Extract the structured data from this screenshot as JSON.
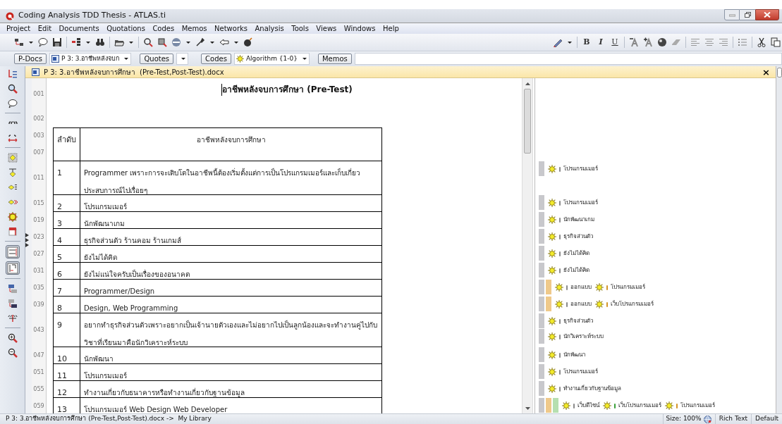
{
  "window": {
    "title": "Coding Analysis TDD Thesis - ATLAS.ti"
  },
  "menu": [
    "Project",
    "Edit",
    "Documents",
    "Quotations",
    "Codes",
    "Memos",
    "Networks",
    "Analysis",
    "Tools",
    "Views",
    "Windows",
    "Help"
  ],
  "format_toolbar": {
    "bold": "B",
    "italic": "I",
    "underline": "U"
  },
  "selectors": {
    "docs_button": "P-Docs",
    "doc_value": "P 3: 3.อาชีพหลังจบก",
    "quotes_button": "Quotes",
    "codes_button": "Codes",
    "code_value": "Algorithm {1-0}",
    "memos_button": "Memos"
  },
  "left_toolbar": [
    {
      "pressed": false
    },
    {
      "pressed": false
    },
    {
      "pressed": false
    },
    {
      "pressed": false
    },
    {
      "pressed": false
    },
    {
      "pressed": false
    },
    {
      "pressed": false
    },
    {
      "pressed": false
    },
    {
      "pressed": false
    },
    {
      "pressed": false
    },
    {
      "pressed": false
    },
    {
      "pressed": true
    },
    {
      "pressed": true
    },
    {
      "pressed": false
    },
    {
      "pressed": false
    },
    {
      "pressed": false
    },
    {
      "pressed": false
    },
    {
      "pressed": false
    }
  ],
  "document": {
    "header": "P 3: 3.อาชีพหลังจบการศึกษา  (Pre-Test,Post-Test).docx",
    "close": "×",
    "title": "อาชีพหลังจบการศึกษา (Pre-Test)",
    "title_line": "001",
    "blank_line": "002",
    "table": {
      "header_lines": [
        "003",
        "007"
      ],
      "columns": [
        "ลำดับ",
        "อาชีพหลังจบการศึกษา"
      ],
      "rows": [
        {
          "line": "011",
          "number": "1",
          "text": "Programmer เพราะการจะเติบโตในอาชีพนี้ต้องเริ่มตั้งแต่การเป็นโปรแกรมเมอร์และเก็บเกี่ยวประสบการณ์ไปเรื่อยๆ",
          "margin": [
            {
              "bars": [
                {
                  "color": "#c8c8cc"
                }
              ],
              "codes": [
                {
                  "label": "โปรแกรมเมอร์",
                  "color": "#8a8a8a"
                }
              ]
            }
          ]
        },
        {
          "line": "015",
          "number": "2",
          "text": "โปรแกรมเมอร์",
          "margin": [
            {
              "bars": [
                {
                  "color": "#c8c8cc"
                }
              ],
              "codes": [
                {
                  "label": "โปรแกรมเมอร์",
                  "color": "#8a8a8a"
                }
              ]
            }
          ]
        },
        {
          "line": "019",
          "number": "3",
          "text": "นักพัฒนาเกม",
          "margin": [
            {
              "bars": [
                {
                  "color": "#c8c8cc"
                }
              ],
              "codes": [
                {
                  "label": "นักพัฒนาเกม",
                  "color": "#8a8a8a"
                }
              ]
            }
          ]
        },
        {
          "line": "023",
          "number": "4",
          "text": "ธุรกิจส่วนตัว ร้านคอม ร้านเกมส์",
          "margin": [
            {
              "bars": [
                {
                  "color": "#c8c8cc"
                }
              ],
              "codes": [
                {
                  "label": "ธุรกิจส่วนตัว",
                  "color": "#8a8a8a"
                }
              ]
            }
          ]
        },
        {
          "line": "027",
          "number": "5",
          "text": "ยังไม่ได้คิด",
          "margin": [
            {
              "bars": [
                {
                  "color": "#c8c8cc"
                }
              ],
              "codes": [
                {
                  "label": "ยังไม่ได้คิด",
                  "color": "#8a8a8a"
                }
              ]
            }
          ]
        },
        {
          "line": "031",
          "number": "6",
          "text": "ยังไม่แน่ใจครับเป็นเรื่องของอนาคต",
          "margin": [
            {
              "bars": [
                {
                  "color": "#c8c8cc"
                }
              ],
              "codes": [
                {
                  "label": "ยังไม่ได้คิด",
                  "color": "#8a8a8a"
                }
              ]
            }
          ]
        },
        {
          "line": "035",
          "number": "7",
          "text": "Programmer/Design",
          "margin": [
            {
              "bars": [
                {
                  "color": "#c8c8cc"
                },
                {
                  "color": "#efc98a"
                }
              ],
              "codes": [
                {
                  "label": "ออกแบบ",
                  "color": "#8a8a8a"
                },
                {
                  "label": "โปรแกรมเมอร์",
                  "color": "#d4952a"
                }
              ]
            }
          ]
        },
        {
          "line": "039",
          "number": "8",
          "text": "Design, Web Programming",
          "margin": [
            {
              "bars": [
                {
                  "color": "#c8c8cc"
                },
                {
                  "color": "#efc98a"
                }
              ],
              "codes": [
                {
                  "label": "ออกแบบ",
                  "color": "#8a8a8a"
                },
                {
                  "label": "เว็บโปรแกรมเมอร์",
                  "color": "#d4952a"
                }
              ]
            }
          ]
        },
        {
          "line": "043",
          "number": "9",
          "text": "อยากทำธุรกิจส่วนตัวเพราะอยากเป็นเจ้านายตัวเองและไม่อยากไปเป็นลูกน้องและจะทำงานคู่ไปกับวิชาที่เรียนมาคือนักวิเคราะห์ระบบ",
          "margin": [
            {
              "bars": [
                {
                  "color": "#c8c8cc"
                }
              ],
              "codes": [
                {
                  "label": "ธุรกิจส่วนตัว",
                  "color": "#8a8a8a"
                }
              ]
            },
            {
              "bars": [
                {
                  "color": "#c8c8cc"
                }
              ],
              "codes": [
                {
                  "label": "นักวิเคราะห์ระบบ",
                  "color": "#8a8a8a"
                }
              ]
            }
          ]
        },
        {
          "line": "047",
          "number": "10",
          "text": "นักพัฒนา",
          "margin": [
            {
              "bars": [
                {
                  "color": "#c8c8cc"
                }
              ],
              "codes": [
                {
                  "label": "นักพัฒนา",
                  "color": "#8a8a8a"
                }
              ]
            }
          ]
        },
        {
          "line": "051",
          "number": "11",
          "text": "โปรแกรมเมอร์",
          "margin": [
            {
              "bars": [
                {
                  "color": "#c8c8cc"
                }
              ],
              "codes": [
                {
                  "label": "โปรแกรมเมอร์",
                  "color": "#8a8a8a"
                }
              ]
            }
          ]
        },
        {
          "line": "055",
          "number": "12",
          "text": "ทำงานเกี่ยวกับธนาคารหรือทำงานเกี่ยวกับฐานข้อมูล",
          "margin": [
            {
              "bars": [
                {
                  "color": "#c8c8cc"
                }
              ],
              "codes": [
                {
                  "label": "ทำงานเกี่ยวกับฐานข้อมูล",
                  "color": "#8a8a8a"
                }
              ]
            }
          ]
        },
        {
          "line": "059",
          "number": "13",
          "text": "โปรแกรมเมอร์ Web Design Web Developer",
          "margin": [
            {
              "bars": [
                {
                  "color": "#c8c8cc"
                },
                {
                  "color": "#efc98a"
                },
                {
                  "color": "#b6dfb0"
                }
              ],
              "codes": [
                {
                  "label": "เว็บดีไซน์",
                  "color": "#8a8a8a"
                },
                {
                  "label": "เว็บโปรแกรมเมอร์",
                  "color": "#3aa03a"
                },
                {
                  "label": "โปรแกรมเมอร์",
                  "color": "#d4952a"
                }
              ]
            }
          ]
        }
      ]
    }
  },
  "status_bar": {
    "path": "P 3: 3.อาชีพหลังจบการศึกษา (Pre-Test,Post-Test).docx ->  My Library",
    "size": "Size: 100%",
    "format": "Rich Text",
    "style": "Default"
  }
}
